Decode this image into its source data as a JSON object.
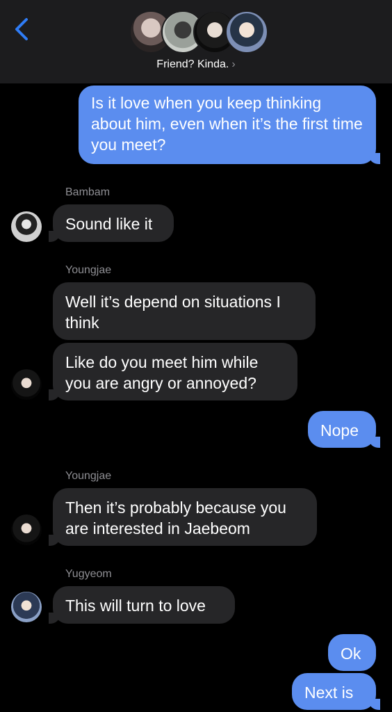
{
  "header": {
    "title": "Friend? Kinda.",
    "chevron": "›",
    "back_icon": "chevron-left-icon",
    "accent": "#2f7cf6"
  },
  "colors": {
    "sent_bubble": "#5b8def",
    "received_bubble": "#262628",
    "background": "#000000",
    "sender_name": "#8e8e93"
  },
  "messages": [
    {
      "type": "sent",
      "text": "Is it love when you keep thinking about him, even when it’s the first time you meet?"
    },
    {
      "type": "sender",
      "text": "Bambam"
    },
    {
      "type": "received",
      "text": "Sound like it"
    },
    {
      "type": "sender",
      "text": "Youngjae"
    },
    {
      "type": "received",
      "text": "Well it’s depend on situations I think"
    },
    {
      "type": "received",
      "text": "Like do you meet him while you are angry or annoyed?"
    },
    {
      "type": "sent",
      "text": "Nope"
    },
    {
      "type": "sender",
      "text": "Youngjae"
    },
    {
      "type": "received",
      "text": "Then it’s probably because you are interested in Jaebeom"
    },
    {
      "type": "sender",
      "text": "Yugyeom"
    },
    {
      "type": "received",
      "text": "This will turn to love"
    },
    {
      "type": "sent",
      "text": "Ok"
    },
    {
      "type": "sent",
      "text": "Next is"
    }
  ]
}
